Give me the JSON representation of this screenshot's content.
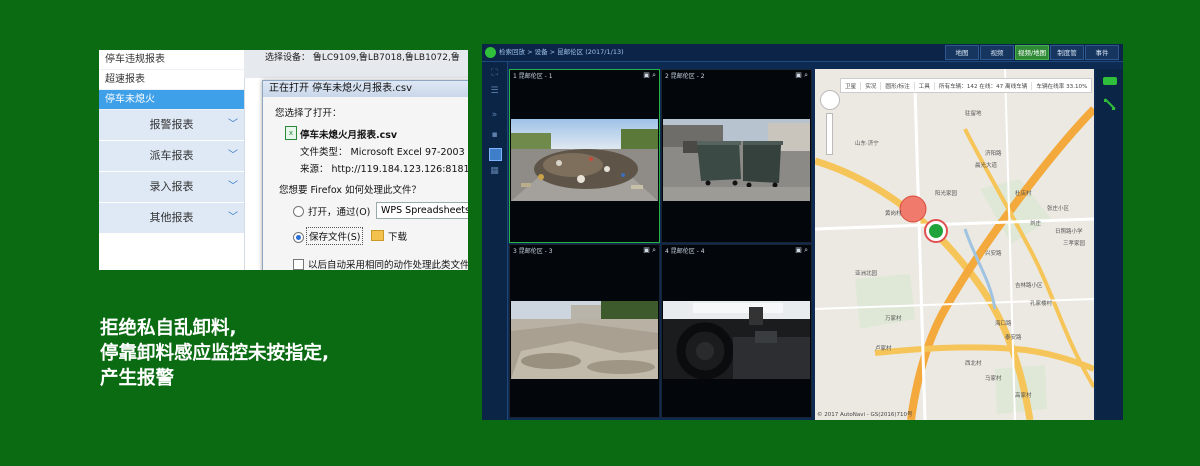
{
  "report_window": {
    "sidebar_items": [
      {
        "label": "停车违规报表"
      },
      {
        "label": "超速报表"
      },
      {
        "label": "停车未熄火",
        "active": true
      }
    ],
    "sidebar_groups": [
      {
        "label": "报警报表"
      },
      {
        "label": "派车报表"
      },
      {
        "label": "录入报表"
      },
      {
        "label": "其他报表"
      }
    ],
    "background_field": "选择设备：  鲁LC9109,鲁LB7018,鲁LB1072,鲁",
    "dialog": {
      "title": "正在打开 停车未熄火月报表.csv",
      "prompt": "您选择了打开：",
      "file_name": "停车未熄火月报表.csv",
      "file_type": "文件类型：  Microsoft Excel 97-2003 工",
      "source": "来源：  http://119.184.123.126:8181",
      "question": "您想要 Firefox 如何处理此文件？",
      "open_with_label": "打开，通过(O)",
      "open_with_app": "WPS Spreadsheets",
      "save_file_label": "保存文件(S)",
      "save_location": "下载",
      "auto_label": "以后自动采用相同的动作处理此类文件"
    }
  },
  "caption": {
    "line1": "拒绝私自乱卸料,",
    "line2": "停靠卸料感应监控未按指定,",
    "line3": "产生报警"
  },
  "monitor_app": {
    "breadcrumb": "检索回放 > 设备 > 昆邮伦区 (2017/1/13)",
    "nav_tabs": [
      {
        "label": "地图"
      },
      {
        "label": "视频"
      },
      {
        "label": "视频/地图",
        "active": true
      },
      {
        "label": "制度管"
      },
      {
        "label": "事件"
      }
    ],
    "cameras": [
      {
        "label": "1 昆邮伦区 - 1",
        "scene": "garbage-pile",
        "selected": true
      },
      {
        "label": "2 昆邮伦区 - 2",
        "scene": "dumpsters"
      },
      {
        "label": "3 昆邮伦区 - 3",
        "scene": "construction-site"
      },
      {
        "label": "4 昆邮伦区 - 4",
        "scene": "truck-cab"
      }
    ],
    "map": {
      "toolbar": [
        "卫星",
        "实况",
        "圆形/标注",
        "工具",
        "所有车辆：142 在线：47 离线车辆",
        "车辆在线率 33.10%"
      ],
      "labels": [
        "山东·济宁",
        "驻留地",
        "济阳路",
        "晨光大道",
        "杜店村",
        "刘庄",
        "张庄小区",
        "日照路小学",
        "三孝家园",
        "黄岗村",
        "阳光家园",
        "兴安路",
        "亚洲北园",
        "吉林路小区",
        "孔家楼村",
        "海口路",
        "泰安路",
        "万家村",
        "卢家村",
        "西北村",
        "马家村",
        "高家村"
      ],
      "footer": "© 2017 AutoNavi - GS(2016)710号"
    }
  }
}
